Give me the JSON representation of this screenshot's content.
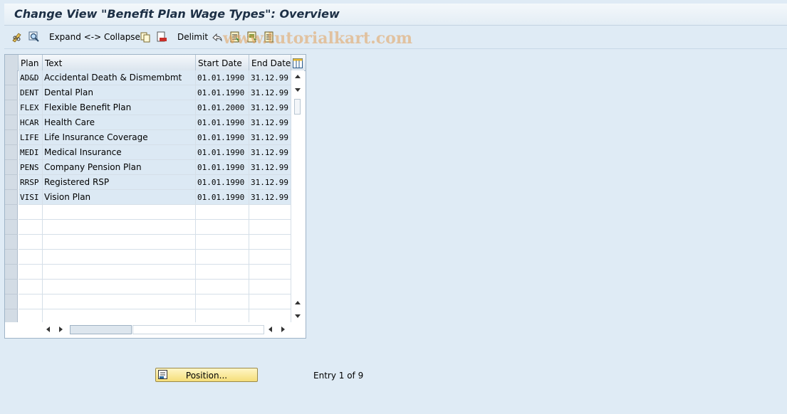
{
  "window": {
    "title": "Change View \"Benefit Plan Wage Types\": Overview"
  },
  "toolbar": {
    "expand_collapse_label": "Expand <-> Collapse",
    "delimit_label": "Delimit",
    "icons": [
      "pencil-glasses-icon",
      "find-icon",
      "copy-icon",
      "delete-icon",
      "undo-icon",
      "select-all-icon",
      "select-block-icon",
      "deselect-icon"
    ]
  },
  "watermark": {
    "text": "www.tutorialkart.com"
  },
  "table": {
    "columns": [
      "Plan",
      "Text",
      "Start Date",
      "End Date"
    ],
    "rows": [
      {
        "plan": "AD&D",
        "text": "Accidental Death & Dismembmt",
        "start": "01.01.1990",
        "end": "31.12.99"
      },
      {
        "plan": "DENT",
        "text": "Dental Plan",
        "start": "01.01.1990",
        "end": "31.12.99"
      },
      {
        "plan": "FLEX",
        "text": "Flexible Benefit Plan",
        "start": "01.01.2000",
        "end": "31.12.99"
      },
      {
        "plan": "HCAR",
        "text": "Health Care",
        "start": "01.01.1990",
        "end": "31.12.99"
      },
      {
        "plan": "LIFE",
        "text": "Life Insurance Coverage",
        "start": "01.01.1990",
        "end": "31.12.99"
      },
      {
        "plan": "MEDI",
        "text": "Medical Insurance",
        "start": "01.01.1990",
        "end": "31.12.99"
      },
      {
        "plan": "PENS",
        "text": "Company Pension Plan",
        "start": "01.01.1990",
        "end": "31.12.99"
      },
      {
        "plan": "RRSP",
        "text": "Registered RSP",
        "start": "01.01.1990",
        "end": "31.12.99"
      },
      {
        "plan": "VISI",
        "text": "Vision Plan",
        "start": "01.01.1990",
        "end": "31.12.99"
      }
    ],
    "empty_rows": 8
  },
  "footer": {
    "position_button": "Position...",
    "entry_info": "Entry 1 of 9"
  },
  "colors": {
    "background": "#dfebf5",
    "row_fill": "#dce9f4",
    "button": "#f5de79"
  }
}
